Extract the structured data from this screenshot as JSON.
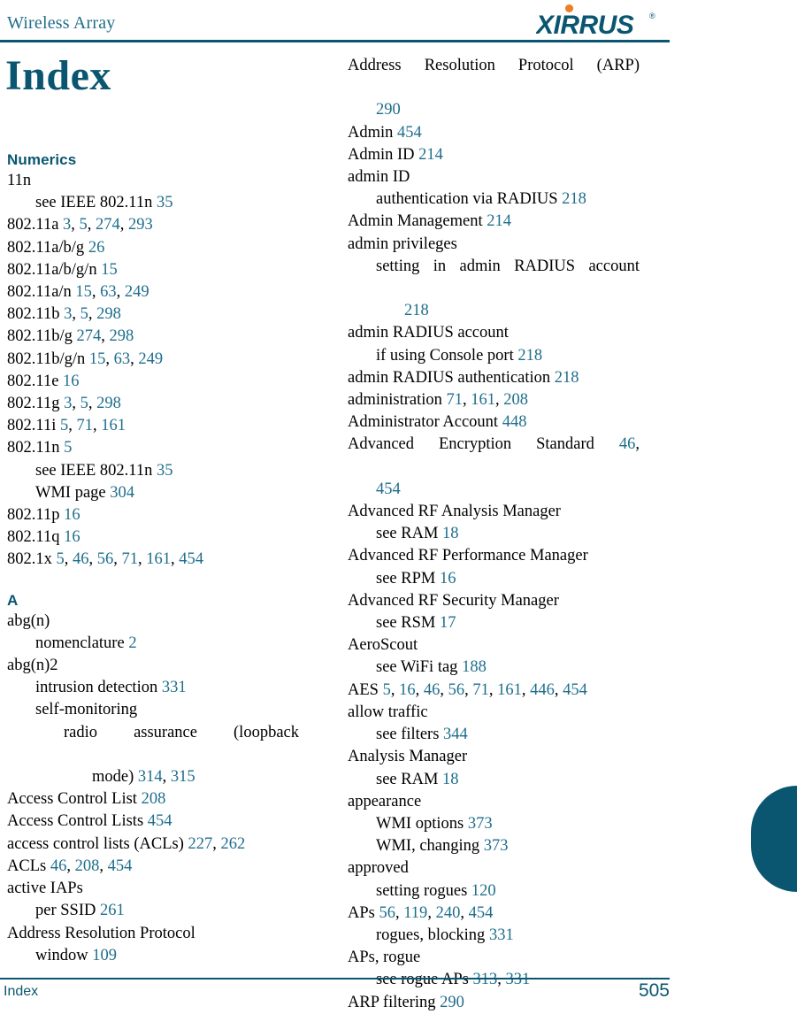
{
  "header": {
    "title": "Wireless Array",
    "logo_text": "XIRRUS",
    "logo_trademark": "®",
    "brand_color": "#0A5671",
    "accent_color": "#F07D24"
  },
  "page_title": "Index",
  "link_color": "#1F6E8C",
  "footer": {
    "left_label": "Index",
    "page_number": "505"
  },
  "left_column": {
    "sections": [
      {
        "heading": "Numerics",
        "entries": [
          {
            "level": 1,
            "text": "11n",
            "pages": []
          },
          {
            "level": 2,
            "text": "see IEEE 802.11n",
            "pages": [
              "35"
            ]
          },
          {
            "level": 1,
            "text": "802.11a",
            "pages": [
              "3",
              "5",
              "274",
              "293"
            ]
          },
          {
            "level": 1,
            "text": "802.11a/b/g",
            "pages": [
              "26"
            ]
          },
          {
            "level": 1,
            "text": "802.11a/b/g/n",
            "pages": [
              "15"
            ]
          },
          {
            "level": 1,
            "text": "802.11a/n",
            "pages": [
              "15",
              "63",
              "249"
            ]
          },
          {
            "level": 1,
            "text": "802.11b",
            "pages": [
              "3",
              "5",
              "298"
            ]
          },
          {
            "level": 1,
            "text": "802.11b/g",
            "pages": [
              "274",
              "298"
            ]
          },
          {
            "level": 1,
            "text": "802.11b/g/n",
            "pages": [
              "15",
              "63",
              "249"
            ]
          },
          {
            "level": 1,
            "text": "802.11e",
            "pages": [
              "16"
            ]
          },
          {
            "level": 1,
            "text": "802.11g",
            "pages": [
              "3",
              "5",
              "298"
            ]
          },
          {
            "level": 1,
            "text": "802.11i",
            "pages": [
              "5",
              "71",
              "161"
            ]
          },
          {
            "level": 1,
            "text": "802.11n",
            "pages": [
              "5"
            ]
          },
          {
            "level": 2,
            "text": "see IEEE 802.11n",
            "pages": [
              "35"
            ]
          },
          {
            "level": 2,
            "text": "WMI page",
            "pages": [
              "304"
            ]
          },
          {
            "level": 1,
            "text": "802.11p",
            "pages": [
              "16"
            ]
          },
          {
            "level": 1,
            "text": "802.11q",
            "pages": [
              "16"
            ]
          },
          {
            "level": 1,
            "text": "802.1x",
            "pages": [
              "5",
              "46",
              "56",
              "71",
              "161",
              "454"
            ]
          }
        ]
      },
      {
        "heading": "A",
        "entries": [
          {
            "level": 1,
            "text": "abg(n)",
            "pages": []
          },
          {
            "level": 2,
            "text": "nomenclature",
            "pages": [
              "2"
            ]
          },
          {
            "level": 1,
            "text": "abg(n)2",
            "pages": []
          },
          {
            "level": 2,
            "text": "intrusion detection",
            "pages": [
              "331"
            ]
          },
          {
            "level": 2,
            "text": "self-monitoring",
            "pages": []
          },
          {
            "level": 3,
            "text": "radio assurance (loopback",
            "pages": [],
            "justified": true
          },
          {
            "level": 4,
            "text": "mode)",
            "pages": [
              "314",
              "315"
            ]
          },
          {
            "level": 1,
            "text": "Access Control List",
            "pages": [
              "208"
            ]
          },
          {
            "level": 1,
            "text": "Access Control Lists",
            "pages": [
              "454"
            ]
          },
          {
            "level": 1,
            "text": "access control lists (ACLs)",
            "pages": [
              "227",
              "262"
            ]
          },
          {
            "level": 1,
            "text": "ACLs",
            "pages": [
              "46",
              "208",
              "454"
            ]
          },
          {
            "level": 1,
            "text": "active IAPs",
            "pages": []
          },
          {
            "level": 2,
            "text": "per SSID",
            "pages": [
              "261"
            ]
          },
          {
            "level": 1,
            "text": "Address Resolution Protocol",
            "pages": []
          },
          {
            "level": 2,
            "text": "window",
            "pages": [
              "109"
            ]
          }
        ]
      }
    ]
  },
  "right_column": {
    "entries": [
      {
        "level": 1,
        "text": "Address Resolution Protocol (ARP)",
        "pages": [],
        "justified": true
      },
      {
        "level": 2,
        "text": "",
        "pages": [
          "290"
        ]
      },
      {
        "level": 1,
        "text": "Admin",
        "pages": [
          "454"
        ]
      },
      {
        "level": 1,
        "text": "Admin ID",
        "pages": [
          "214"
        ]
      },
      {
        "level": 1,
        "text": "admin ID",
        "pages": []
      },
      {
        "level": 2,
        "text": "authentication via RADIUS",
        "pages": [
          "218"
        ]
      },
      {
        "level": 1,
        "text": "Admin Management",
        "pages": [
          "214"
        ]
      },
      {
        "level": 1,
        "text": "admin privileges",
        "pages": []
      },
      {
        "level": 2,
        "text": "setting in admin RADIUS account",
        "pages": [],
        "justified": true
      },
      {
        "level": 3,
        "text": "",
        "pages": [
          "218"
        ]
      },
      {
        "level": 1,
        "text": "admin RADIUS account",
        "pages": []
      },
      {
        "level": 2,
        "text": "if using Console port",
        "pages": [
          "218"
        ]
      },
      {
        "level": 1,
        "text": "admin RADIUS authentication",
        "pages": [
          "218"
        ]
      },
      {
        "level": 1,
        "text": "administration",
        "pages": [
          "71",
          "161",
          "208"
        ]
      },
      {
        "level": 1,
        "text": "Administrator Account",
        "pages": [
          "448"
        ]
      },
      {
        "level": 1,
        "text": "Advanced Encryption Standard",
        "pages": [
          "46"
        ],
        "justified": true,
        "trailing_comma": true
      },
      {
        "level": 2,
        "text": "",
        "pages": [
          "454"
        ]
      },
      {
        "level": 1,
        "text": "Advanced RF Analysis Manager",
        "pages": []
      },
      {
        "level": 2,
        "text": "see RAM",
        "pages": [
          "18"
        ]
      },
      {
        "level": 1,
        "text": "Advanced RF Performance Manager",
        "pages": []
      },
      {
        "level": 2,
        "text": "see RPM",
        "pages": [
          "16"
        ]
      },
      {
        "level": 1,
        "text": "Advanced RF Security Manager",
        "pages": []
      },
      {
        "level": 2,
        "text": "see RSM",
        "pages": [
          "17"
        ]
      },
      {
        "level": 1,
        "text": "AeroScout",
        "pages": []
      },
      {
        "level": 2,
        "text": "see WiFi tag",
        "pages": [
          "188"
        ]
      },
      {
        "level": 1,
        "text": "AES",
        "pages": [
          "5",
          "16",
          "46",
          "56",
          "71",
          "161",
          "446",
          "454"
        ]
      },
      {
        "level": 1,
        "text": "allow traffic",
        "pages": []
      },
      {
        "level": 2,
        "text": "see filters",
        "pages": [
          "344"
        ]
      },
      {
        "level": 1,
        "text": "Analysis Manager",
        "pages": []
      },
      {
        "level": 2,
        "text": "see RAM",
        "pages": [
          "18"
        ]
      },
      {
        "level": 1,
        "text": "appearance",
        "pages": []
      },
      {
        "level": 2,
        "text": "WMI options",
        "pages": [
          "373"
        ]
      },
      {
        "level": 2,
        "text": "WMI, changing",
        "pages": [
          "373"
        ]
      },
      {
        "level": 1,
        "text": "approved",
        "pages": []
      },
      {
        "level": 2,
        "text": "setting rogues",
        "pages": [
          "120"
        ]
      },
      {
        "level": 1,
        "text": "APs",
        "pages": [
          "56",
          "119",
          "240",
          "454"
        ]
      },
      {
        "level": 2,
        "text": "rogues, blocking",
        "pages": [
          "331"
        ]
      },
      {
        "level": 1,
        "text": "APs, rogue",
        "pages": []
      },
      {
        "level": 2,
        "text": "see rogue APs",
        "pages": [
          "313",
          "331"
        ]
      },
      {
        "level": 1,
        "text": "ARP filtering",
        "pages": [
          "290"
        ]
      }
    ]
  }
}
